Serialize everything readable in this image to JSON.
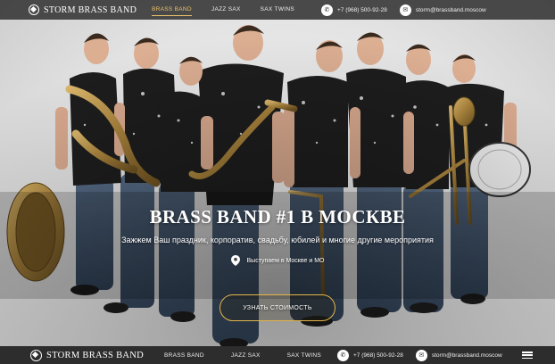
{
  "brand": "STORM BRASS BAND",
  "nav": {
    "items": [
      "BRASS BAND",
      "JAZZ SAX",
      "SAX TWINS"
    ],
    "active_index": 0
  },
  "contact": {
    "phone": "+7 (968) 500-92-28",
    "email": "storm@brassband.moscow"
  },
  "bottom_nav": {
    "items": [
      "BRASS BAND",
      "JAZZ SAX",
      "SAX TWINS"
    ],
    "phone": "+7 (968) 500-92-28",
    "email": "storm@brassband.moscow"
  },
  "hero": {
    "title": "BRASS BAND #1 В МОСКВЕ",
    "subtitle": "Зажжем Ваш праздник, корпоратив, свадьбу, юбилей и многие другие мероприятия",
    "location": "Выступаем в Москве и МО",
    "cta": "УЗНАТЬ СТОИМОСТЬ"
  },
  "colors": {
    "accent": "#e3b64a",
    "nav_bg": "#3c3c3c",
    "bottom_bg": "#2d2d2d"
  },
  "icons": {
    "logo": "storm-logo-icon",
    "phone": "phone-icon",
    "email": "email-icon",
    "location": "map-pin-icon",
    "menu": "hamburger-menu-icon"
  }
}
